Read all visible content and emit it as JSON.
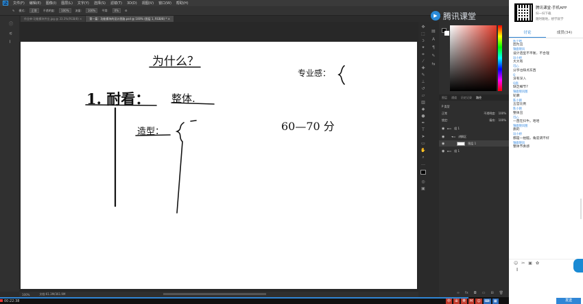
{
  "ps": {
    "logo": "Ps",
    "menu": [
      "文件(F)",
      "编辑(E)",
      "图像(I)",
      "图层(L)",
      "文字(Y)",
      "选择(S)",
      "滤镜(T)",
      "3D(D)",
      "视图(V)",
      "窗口(W)",
      "帮助(H)"
    ],
    "options": {
      "mode_label": "模式:",
      "mode_value": "正常",
      "opacity_label": "不透明度:",
      "opacity_value": "100%",
      "flow_label": "流量:",
      "flow_value": "100%",
      "smooth_label": "平滑:",
      "smooth_value": "0%"
    },
    "tabs": [
      {
        "label": "作业单-功能模块件业.jpg @ 33.3%(RGB/8) ×"
      },
      {
        "label": "第一篇：功能模块的设计思路.psd @ 100% (图层 1, RGB/8) * ×"
      }
    ],
    "status": {
      "zoom": "100%",
      "doc": "文档:61.3M/361.9M"
    },
    "layers": {
      "tabs": [
        "图层",
        "通道",
        "历史记录",
        "路径"
      ],
      "active_tab": "图层",
      "filter_label": "P 类型",
      "blend": "正常",
      "opacity_label": "不透明度:",
      "opacity_value": "100%",
      "lock_label": "锁定:",
      "fill_label": "填充:",
      "fill_value": "100%",
      "rows": [
        {
          "name": "组 1"
        },
        {
          "name": "讲解区"
        },
        {
          "name": "图层 1"
        },
        {
          "name": "组 1"
        }
      ]
    }
  },
  "canvas_handwriting": {
    "heading": "为什么？",
    "item1": "1. 耐看：",
    "item1_tag": "整体.",
    "sub": "造型：",
    "right_top": "专业感：",
    "right_range": "60—70 分"
  },
  "watermark": "腾讯课堂",
  "player": {
    "time": "00:22:38",
    "progress_percent": 92,
    "tasks": [
      "中",
      "ㄓ",
      "英",
      "M",
      "☺",
      "⌨",
      "▦"
    ]
  },
  "sidebar": {
    "promo_title": "腾讯课堂-手机APP",
    "promo_line1": "扫一扫下载",
    "promo_line2": "随时随地，想学就学",
    "tabs": [
      "讨论",
      "成员(34)"
    ],
    "active_tab": "讨论",
    "messages": [
      {
        "who": "陈小刚",
        "text": "因为丑"
      },
      {
        "who": "锦鹿晓风",
        "text": "设计造型不平衡，不合理"
      },
      {
        "who": "逗小桥",
        "text": "大大有"
      },
      {
        "who": "可心",
        "text": "分字也缺点东西"
      },
      {
        "who": "Q",
        "text": "没有深入"
      },
      {
        "who": "Q面",
        "text": "缺乏细节?"
      },
      {
        "who": "锦鹿晓风图",
        "text": "轮廓"
      },
      {
        "who": "陈小刚",
        "text": "五官比例"
      },
      {
        "who": "陈小刚",
        "text": "整体丑"
      },
      {
        "who": "可心",
        "text": "一直在抖牛。哈哈"
      },
      {
        "who": "锦鹿晓风图",
        "text": "质的"
      },
      {
        "who": "逗小桥",
        "text": "都是一拍脑，角度调不好"
      },
      {
        "who": "锦鹿晓风",
        "text": "整体节奏感"
      }
    ],
    "tools_right": "↓",
    "send_label": "发送"
  }
}
